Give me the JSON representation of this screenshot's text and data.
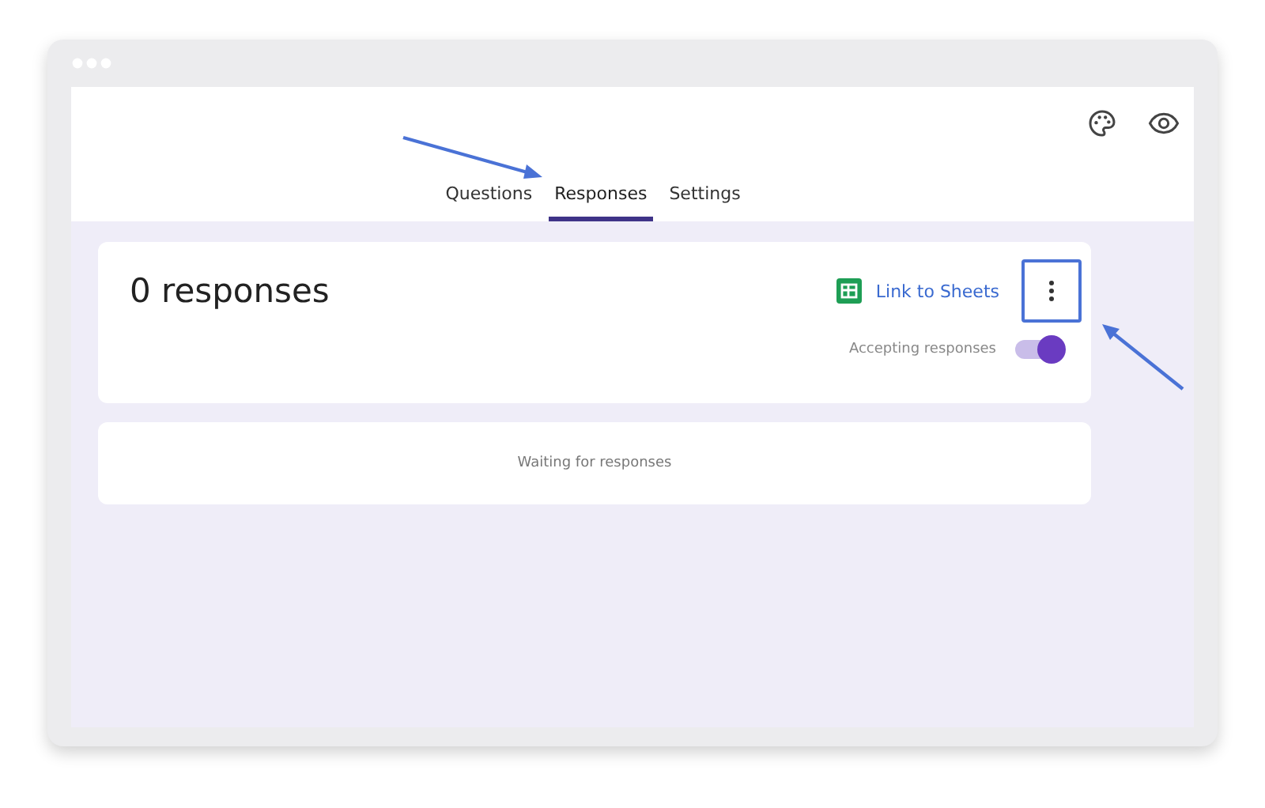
{
  "tabs": [
    {
      "label": "Questions",
      "selected": false
    },
    {
      "label": "Responses",
      "selected": true
    },
    {
      "label": "Settings",
      "selected": false
    }
  ],
  "summary": {
    "title": "0 responses",
    "link_label": "Link to Sheets",
    "accepting_label": "Accepting responses",
    "accepting": true
  },
  "empty_state": {
    "message": "Waiting for responses"
  }
}
